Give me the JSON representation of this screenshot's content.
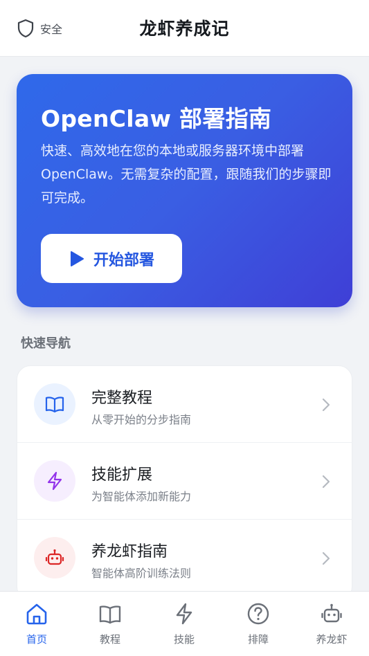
{
  "header": {
    "security_label": "安全",
    "title": "龙虾养成记"
  },
  "hero": {
    "title": "OpenClaw 部署指南",
    "description": "快速、高效地在您的本地或服务器环境中部署 OpenClaw。无需复杂的配置，跟随我们的步骤即可完成。",
    "button_label": "开始部署"
  },
  "quick_nav": {
    "title": "快速导航",
    "items": [
      {
        "title": "完整教程",
        "subtitle": "从零开始的分步指南",
        "icon": "book-icon",
        "color": "#2563eb",
        "bg": "#eaf2ff"
      },
      {
        "title": "技能扩展",
        "subtitle": "为智能体添加新能力",
        "icon": "lightning-icon",
        "color": "#9333ea",
        "bg": "#f6eefe"
      },
      {
        "title": "养龙虾指南",
        "subtitle": "智能体高阶训练法则",
        "icon": "robot-icon",
        "color": "#dc2626",
        "bg": "#fdeeee"
      }
    ]
  },
  "tabbar": {
    "tabs": [
      {
        "label": "首页",
        "icon": "home-icon",
        "active": true
      },
      {
        "label": "教程",
        "icon": "book-icon"
      },
      {
        "label": "技能",
        "icon": "lightning-icon"
      },
      {
        "label": "排障",
        "icon": "help-circle-icon"
      },
      {
        "label": "养龙虾",
        "icon": "robot-icon"
      }
    ]
  },
  "colors": {
    "accent": "#2563eb",
    "hero_gradient_start": "#2f69ea",
    "hero_gradient_end": "#3f3fd6"
  }
}
